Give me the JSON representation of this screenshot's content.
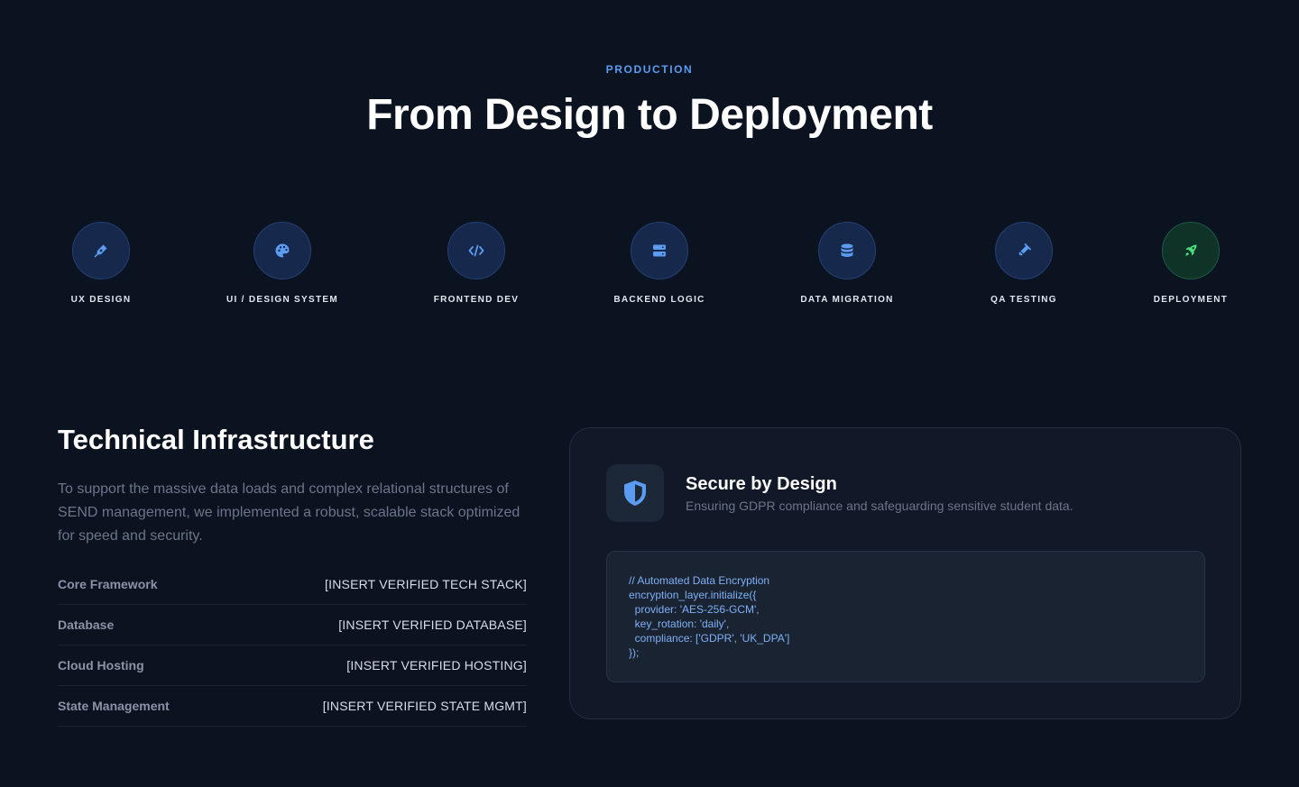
{
  "hero": {
    "eyebrow": "PRODUCTION",
    "title": "From Design to Deployment"
  },
  "pipeline": {
    "accent_color": "#5b9cf0",
    "success_color": "#4ade80",
    "steps": [
      {
        "label": "UX DESIGN",
        "icon": "pen-nib-icon"
      },
      {
        "label": "UI / DESIGN SYSTEM",
        "icon": "palette-icon"
      },
      {
        "label": "FRONTEND DEV",
        "icon": "code-icon"
      },
      {
        "label": "BACKEND LOGIC",
        "icon": "server-icon"
      },
      {
        "label": "DATA MIGRATION",
        "icon": "database-icon"
      },
      {
        "label": "QA TESTING",
        "icon": "vial-icon"
      },
      {
        "label": "DEPLOYMENT",
        "icon": "rocket-icon"
      }
    ]
  },
  "infrastructure": {
    "title": "Technical Infrastructure",
    "description": "To support the massive data loads and complex relational structures of SEND management, we implemented a robust, scalable stack optimized for speed and security.",
    "specs": [
      {
        "key": "Core Framework",
        "value": "[INSERT VERIFIED TECH STACK]"
      },
      {
        "key": "Database",
        "value": "[INSERT VERIFIED DATABASE]"
      },
      {
        "key": "Cloud Hosting",
        "value": "[INSERT VERIFIED HOSTING]"
      },
      {
        "key": "State Management",
        "value": "[INSERT VERIFIED STATE MGMT]"
      }
    ]
  },
  "security_card": {
    "icon": "shield-icon",
    "title": "Secure by Design",
    "subtitle": "Ensuring GDPR compliance and safeguarding sensitive student data.",
    "code_lines": [
      "// Automated Data Encryption",
      "encryption_layer.initialize({",
      "  provider: 'AES-256-GCM',",
      "  key_rotation: 'daily',",
      "  compliance: ['GDPR', 'UK_DPA']",
      "});"
    ]
  }
}
